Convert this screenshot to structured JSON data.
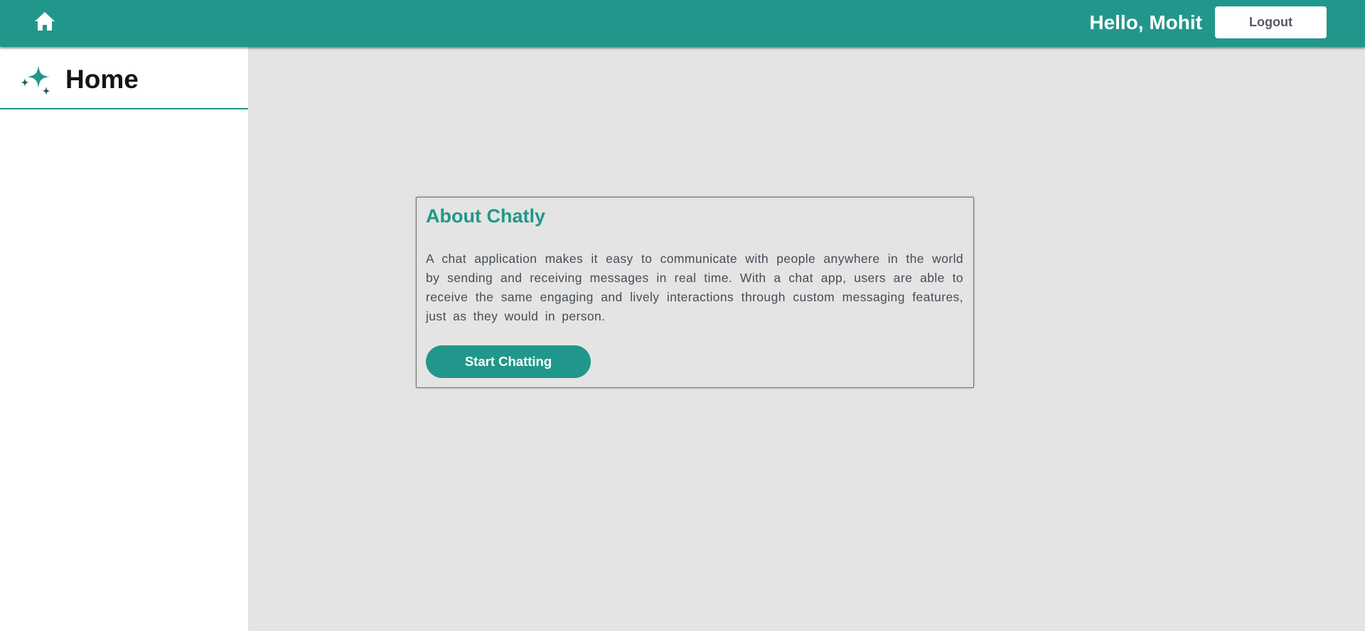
{
  "header": {
    "greeting": "Hello, Mohit",
    "logout_label": "Logout",
    "home_icon": "home-icon",
    "background_color": "#21978b"
  },
  "sidebar": {
    "title": "Home",
    "icon": "sparkle-icon"
  },
  "card": {
    "title": "About Chatly",
    "description": "A chat application makes it easy to communicate with people anywhere in the world by sending and receiving messages in real time. With a chat app, users are able to receive the same engaging and lively interactions through custom messaging features, just as they would in person.",
    "button_label": "Start Chatting"
  },
  "colors": {
    "accent": "#21978b",
    "main_background": "#e4e4e4",
    "sidebar_background": "#ffffff",
    "body_text": "#444c56"
  }
}
